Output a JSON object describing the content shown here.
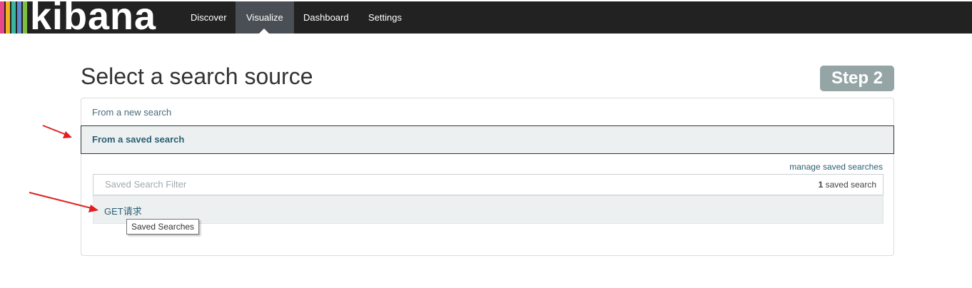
{
  "navbar": {
    "logo_text": "kibana",
    "logo_colors": [
      "#e8478b",
      "#f0b020",
      "#3ab6a0",
      "#5b8bd0",
      "#7fbf3f"
    ],
    "items": [
      {
        "label": "Discover",
        "active": false
      },
      {
        "label": "Visualize",
        "active": true
      },
      {
        "label": "Dashboard",
        "active": false
      },
      {
        "label": "Settings",
        "active": false
      }
    ]
  },
  "page": {
    "title": "Select a search source",
    "step": "Step 2"
  },
  "sources": {
    "new_search_label": "From a new search",
    "saved_search_label": "From a saved search",
    "manage_link": "manage saved searches",
    "filter_placeholder": "Saved Search Filter",
    "count_number": "1",
    "count_suffix": " saved search",
    "results": [
      "GET请求"
    ]
  },
  "tooltip": "Saved Searches",
  "colors": {
    "navbar_bg": "#222222",
    "active_tab_bg": "#4a4f55",
    "step_badge_bg": "#95a5a6",
    "link": "#2c5e72",
    "annotation_arrow": "#e02020"
  }
}
